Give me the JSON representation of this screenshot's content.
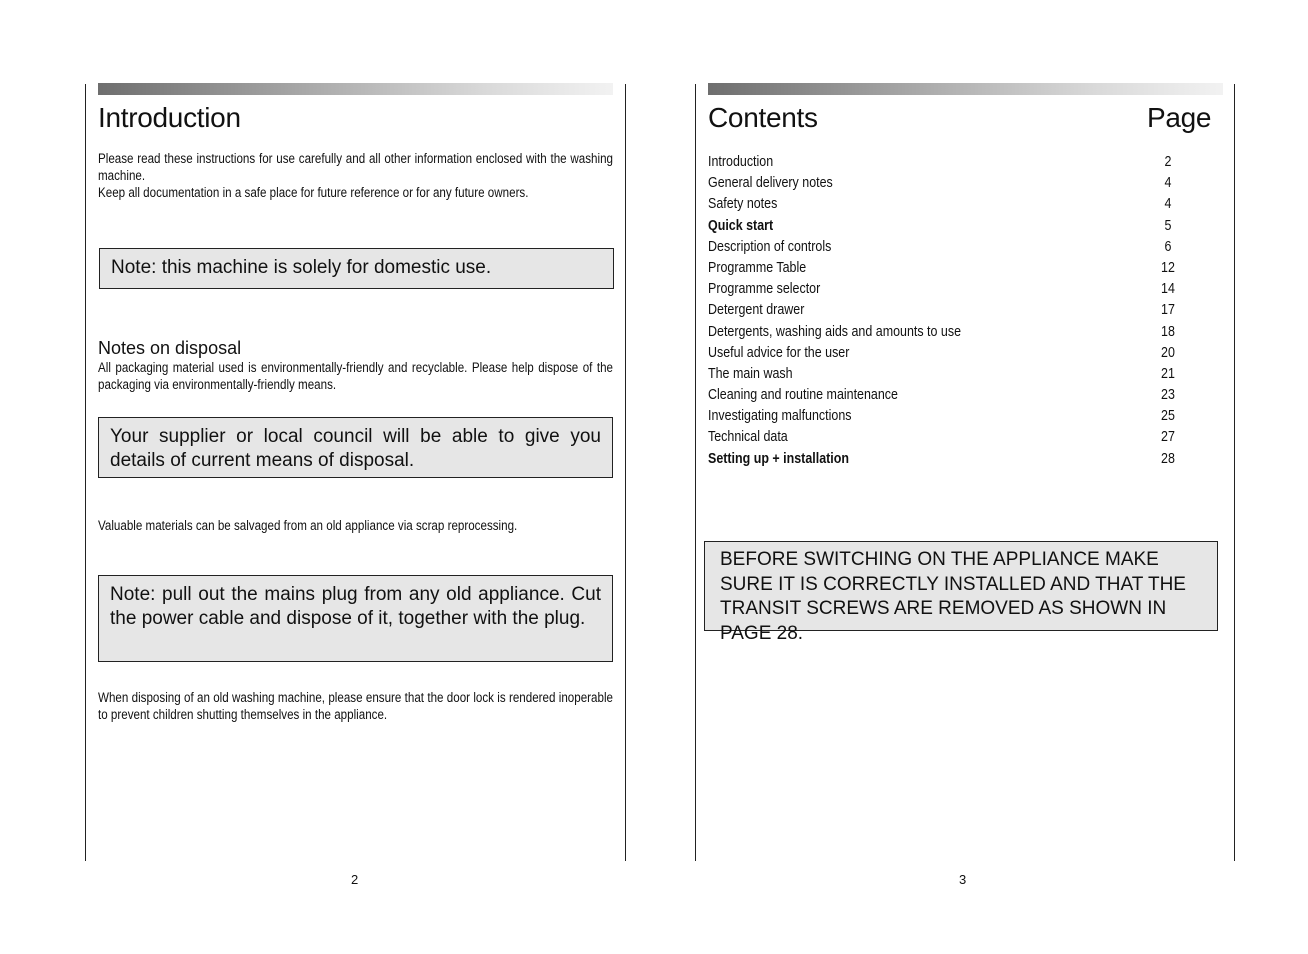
{
  "left_page": {
    "title": "Introduction",
    "intro_line1": "Please read these instructions for use carefully and all other information enclosed with the washing machine.",
    "intro_line2": "Keep all documentation in a safe place for future reference or for any future owners.",
    "note_domestic": "Note: this machine is solely for domestic use.",
    "disposal_heading": "Notes on disposal",
    "disposal_text": "All packaging material used is environmentally-friendly and recyclable. Please help dispose of the packaging via environmentally-friendly means.",
    "note_supplier": "Your supplier or local council will be able to give you details of current means of disposal.",
    "salvage_text": "Valuable materials can be salvaged from an old appliance via scrap reprocessing.",
    "note_plug": "Note: pull out the mains plug from any old appliance. Cut the power cable and dispose of it, together with the plug.",
    "door_lock_text": "When disposing of an old washing machine, please ensure that the door lock is rendered inoperable to prevent children shutting themselves in the appliance.",
    "page_number": "2"
  },
  "right_page": {
    "title": "Contents",
    "page_header": "Page",
    "toc": [
      {
        "title": "Introduction",
        "page": "2",
        "bold": false
      },
      {
        "title": "General delivery notes",
        "page": "4",
        "bold": false
      },
      {
        "title": "Safety notes",
        "page": "4",
        "bold": false
      },
      {
        "title": "Quick start",
        "page": "5",
        "bold": true
      },
      {
        "title": "Description of controls",
        "page": "6",
        "bold": false
      },
      {
        "title": "Programme Table",
        "page": "12",
        "bold": false
      },
      {
        "title": "Programme selector",
        "page": "14",
        "bold": false
      },
      {
        "title": "Detergent drawer",
        "page": "17",
        "bold": false
      },
      {
        "title": "Detergents, washing aids and amounts to use",
        "page": "18",
        "bold": false
      },
      {
        "title": "Useful advice for the user",
        "page": "20",
        "bold": false
      },
      {
        "title": "The main wash",
        "page": "21",
        "bold": false
      },
      {
        "title": "Cleaning and routine maintenance",
        "page": "23",
        "bold": false
      },
      {
        "title": "Investigating malfunctions",
        "page": "25",
        "bold": false
      },
      {
        "title": "Technical data",
        "page": "27",
        "bold": false
      },
      {
        "title": "Setting up +  installation",
        "page": "28",
        "bold": true
      }
    ],
    "warning": "BEFORE SWITCHING ON THE APPLIANCE MAKE SURE IT IS CORRECTLY INSTALLED AND THAT THE TRANSIT SCREWS ARE REMOVED AS SHOWN IN PAGE 28.",
    "page_number": "3"
  }
}
